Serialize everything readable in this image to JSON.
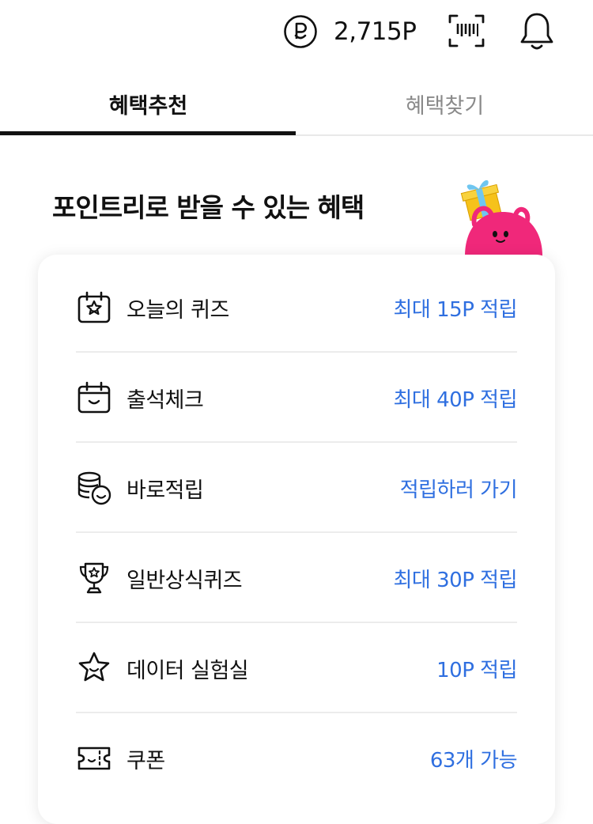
{
  "header": {
    "points_value": "2,715P",
    "icons": [
      "point-coin-icon",
      "barcode-scan-icon",
      "bell-icon"
    ]
  },
  "tabs": [
    {
      "label": "혜택추천",
      "active": true
    },
    {
      "label": "혜택찾기",
      "active": false
    }
  ],
  "section": {
    "title": "포인트리로 받을 수 있는 혜택"
  },
  "benefits": [
    {
      "icon": "calendar-star-icon",
      "label": "오늘의 퀴즈",
      "action": "최대 15P 적립"
    },
    {
      "icon": "calendar-smile-icon",
      "label": "출석체크",
      "action": "최대 40P 적립"
    },
    {
      "icon": "coins-icon",
      "label": "바로적립",
      "action": "적립하러 가기"
    },
    {
      "icon": "trophy-icon",
      "label": "일반상식퀴즈",
      "action": "최대 30P 적립"
    },
    {
      "icon": "star-smile-icon",
      "label": "데이터 실험실",
      "action": "10P 적립"
    },
    {
      "icon": "ticket-icon",
      "label": "쿠폰",
      "action": "63개 가능"
    }
  ],
  "colors": {
    "accent": "#2f6fe0",
    "text": "#111111",
    "inactive_tab": "#8a8a8a",
    "mascot_pink": "#f0287a",
    "gift_yellow": "#f6c21b",
    "ribbon_blue": "#6fc6f0"
  }
}
